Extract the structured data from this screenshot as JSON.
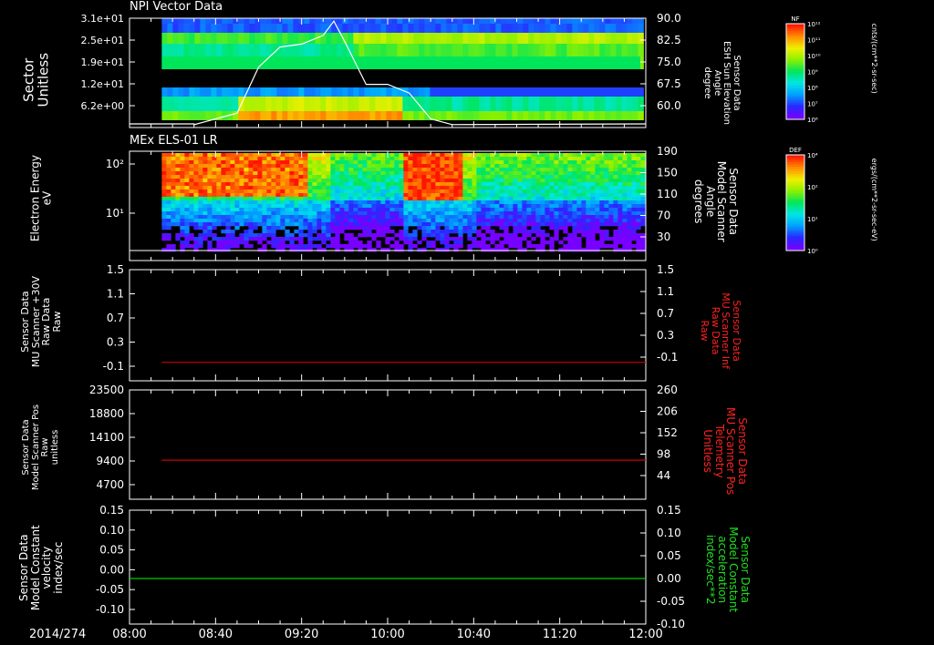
{
  "window": {
    "date_label": "2014/274"
  },
  "time_axis": {
    "ticks": [
      "08:00",
      "08:40",
      "09:20",
      "10:00",
      "10:40",
      "11:20",
      "12:00"
    ]
  },
  "colors": {
    "background": "#000000",
    "axes": "#ffffff",
    "red_trace": "#cc0000",
    "green_trace": "#00cc00",
    "label_red": "#ff2020",
    "label_green": "#20e020"
  },
  "chart_data": [
    {
      "type": "heatmap",
      "title": "NPI Vector Data",
      "ylabel": "Sector\nUnitless",
      "yticks": [
        "3.1e+01",
        "2.5e+01",
        "1.9e+01",
        "1.2e+01",
        "6.2e+00"
      ],
      "right_label": "Sensor Data\nESH Sun Elevation\nAngle\ndegree",
      "right_ticks": [
        "90.0",
        "82.5",
        "75.0",
        "67.5",
        "60.0"
      ],
      "overlay_series": {
        "name": "ESH Sun Elevation Angle",
        "x": [
          "08:30",
          "08:50",
          "09:00",
          "09:10",
          "09:20",
          "09:30",
          "09:35",
          "09:40",
          "09:50",
          "10:00",
          "10:10",
          "10:20",
          "10:30"
        ],
        "y": [
          53,
          57,
          73,
          80,
          81,
          84,
          89,
          82,
          67,
          67,
          64,
          55,
          53
        ]
      },
      "colorbar": {
        "label": "NF",
        "units": "cnts/(cm**2-sr-sec)",
        "ticks": [
          "10¹²",
          "10¹¹",
          "10¹⁰",
          "10⁹",
          "10⁸",
          "10⁷",
          "10⁶"
        ]
      }
    },
    {
      "type": "heatmap",
      "title": "MEx ELS-01 LR",
      "ylabel": "Electron Energy\neV",
      "yticks": [
        "10²",
        "10¹"
      ],
      "right_label": "Sensor Data\nModel Scanner\nAngle\ndegrees",
      "right_ticks": [
        "190",
        "150",
        "110",
        "70",
        "30"
      ],
      "overlay_series": {
        "name": "Model Scanner Angle",
        "x": [
          "08:15",
          "12:00"
        ],
        "y": [
          5,
          5
        ]
      },
      "colorbar": {
        "label": "DEF",
        "units": "ergs/(cm**2-sr-sec-eV)",
        "ticks": [
          "10⁴",
          "10²",
          "10¹",
          "10⁰"
        ]
      }
    },
    {
      "type": "line",
      "ylabel": "Sensor Data\nMU Scanner +30V\nRaw Data\nRaw",
      "yticks": [
        "1.5",
        "1.1",
        "0.7",
        "0.3",
        "-0.1"
      ],
      "ylim": [
        -0.3,
        1.5
      ],
      "right_label": "Sensor Data\nMU Scanner Inf\nRaw Data\nRaw",
      "right_ticks": [
        "1.5",
        "1.1",
        "0.7",
        "0.3",
        "-0.1"
      ],
      "series": [
        {
          "x": [
            "08:15",
            "12:00"
          ],
          "values": [
            0.0,
            0.0
          ]
        }
      ]
    },
    {
      "type": "line",
      "ylabel": "Sensor Data\nModel Scanner Pos\nRaw\nunitless",
      "yticks": [
        "23500",
        "18800",
        "14100",
        "9400",
        "4700"
      ],
      "ylim": [
        0,
        23500
      ],
      "right_label": "Sensor Data\nMU Scanner Pos\nTelemetry\nUnitless",
      "right_ticks": [
        "260",
        "206",
        "152",
        "98",
        "44"
      ],
      "series": [
        {
          "x": [
            "08:15",
            "12:00"
          ],
          "values": [
            8400,
            8400
          ]
        }
      ]
    },
    {
      "type": "line",
      "ylabel": "Sensor Data\nModel Constant\nvelocity\nindex/sec",
      "yticks": [
        "0.15",
        "0.10",
        "0.05",
        "0.00",
        "-0.05",
        "-0.10"
      ],
      "ylim": [
        -0.1,
        0.15
      ],
      "right_label": "Sensor Data\nModel Constant\nacceleration\nindex/sec**2",
      "right_ticks": [
        "0.15",
        "0.10",
        "0.05",
        "0.00",
        "-0.05",
        "-0.10"
      ],
      "series": [
        {
          "x": [
            "08:00",
            "12:00"
          ],
          "values": [
            0.0,
            0.0
          ]
        }
      ]
    }
  ]
}
